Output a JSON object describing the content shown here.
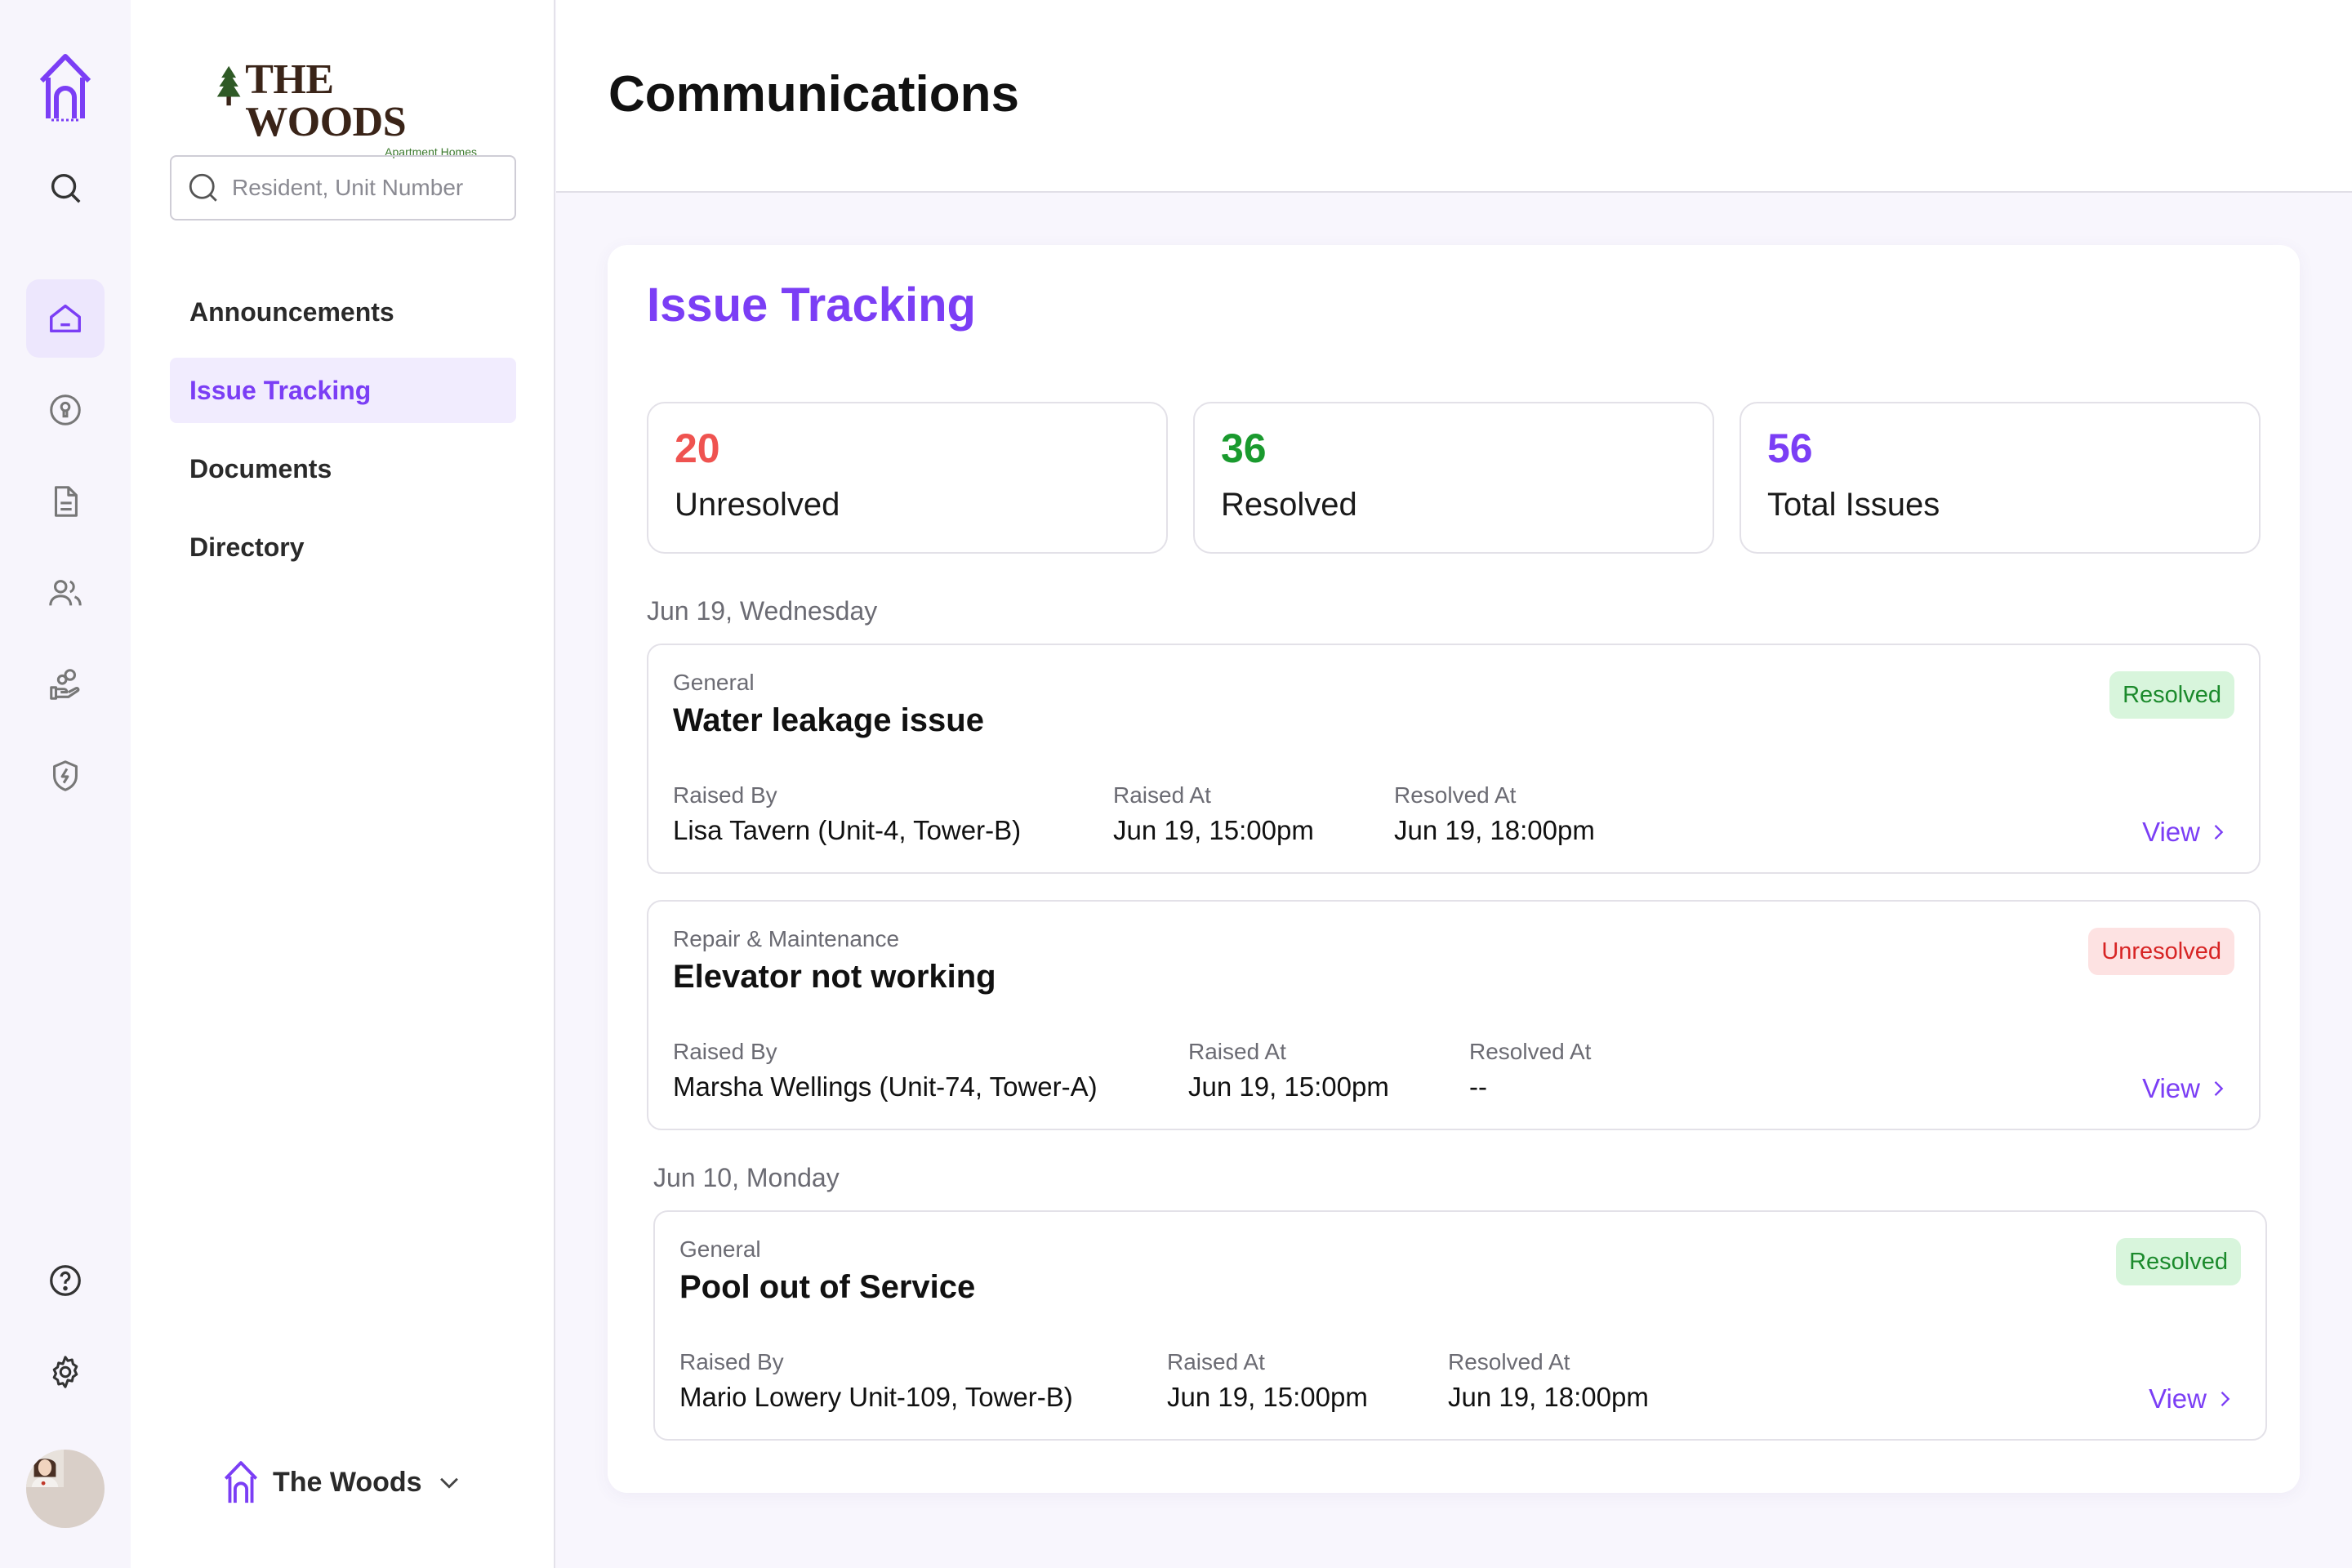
{
  "rail": {
    "icons": [
      "brand-house-icon",
      "search-icon",
      "home-icon",
      "keyhole-icon",
      "document-icon",
      "users-icon",
      "hand-coins-icon",
      "shield-bolt-icon",
      "help-icon",
      "settings-icon"
    ],
    "accent": "#7b3ef5"
  },
  "sidebar": {
    "brand_name": "THE WOODS",
    "brand_sub": "Apartment Homes",
    "search_placeholder": "Resident, Unit Number",
    "items": [
      {
        "label": "Announcements",
        "active": false
      },
      {
        "label": "Issue Tracking",
        "active": true
      },
      {
        "label": "Documents",
        "active": false
      },
      {
        "label": "Directory",
        "active": false
      }
    ],
    "org_name": "The Woods"
  },
  "header": {
    "title": "Communications"
  },
  "main": {
    "title": "Issue Tracking",
    "stats": [
      {
        "value": "20",
        "label": "Unresolved",
        "color": "#ef5350"
      },
      {
        "value": "36",
        "label": "Resolved",
        "color": "#1a9a2e"
      },
      {
        "value": "56",
        "label": "Total Issues",
        "color": "#7b3ef5"
      }
    ],
    "groups": [
      {
        "date": "Jun 19, Wednesday",
        "issues": [
          {
            "category": "General",
            "title": "Water leakage issue",
            "status": "Resolved",
            "raised_by_label": "Raised By",
            "raised_by": "Lisa Tavern (Unit-4, Tower-B)",
            "raised_at_label": "Raised At",
            "raised_at": "Jun 19, 15:00pm",
            "resolved_at_label": "Resolved At",
            "resolved_at": "Jun 19, 18:00pm",
            "view": "View"
          },
          {
            "category": "Repair & Maintenance",
            "title": "Elevator not working",
            "status": "Unresolved",
            "raised_by_label": "Raised By",
            "raised_by": "Marsha Wellings (Unit-74, Tower-A)",
            "raised_at_label": "Raised At",
            "raised_at": "Jun 19, 15:00pm",
            "resolved_at_label": "Resolved At",
            "resolved_at": "--",
            "view": "View"
          }
        ]
      },
      {
        "date": "Jun 10, Monday",
        "issues": [
          {
            "category": "General",
            "title": "Pool out of Service",
            "status": "Resolved",
            "raised_by_label": "Raised By",
            "raised_by": "Mario Lowery Unit-109, Tower-B)",
            "raised_at_label": "Raised At",
            "raised_at": "Jun 19, 15:00pm",
            "resolved_at_label": "Resolved At",
            "resolved_at": "Jun 19, 18:00pm",
            "view": "View"
          }
        ]
      }
    ]
  }
}
